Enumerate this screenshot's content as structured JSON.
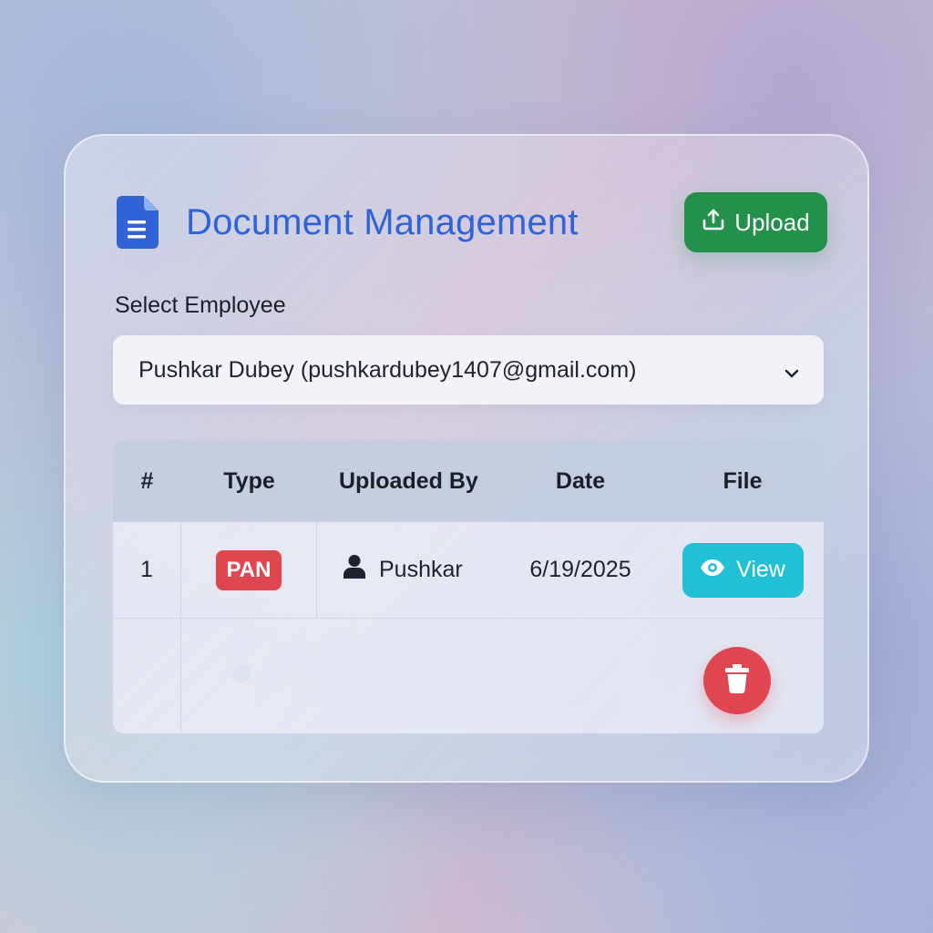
{
  "header": {
    "title": "Document Management",
    "upload_label": "Upload",
    "doc_icon": "document-icon",
    "upload_icon": "upload-icon"
  },
  "employee_select": {
    "label": "Select Employee",
    "selected_value": "Pushkar Dubey (pushkardubey1407@gmail.com)"
  },
  "table": {
    "columns": [
      "#",
      "Type",
      "Uploaded By",
      "Date",
      "File"
    ],
    "rows": [
      {
        "num": "1",
        "type": "PAN",
        "uploaded_by": "Pushkar",
        "date": "6/19/2025",
        "file_action": "View"
      }
    ]
  },
  "colors": {
    "title": "#2f63d6",
    "upload": "#23914c",
    "badge": "#e0464f",
    "view": "#22c0d4",
    "delete": "#e0464f"
  }
}
